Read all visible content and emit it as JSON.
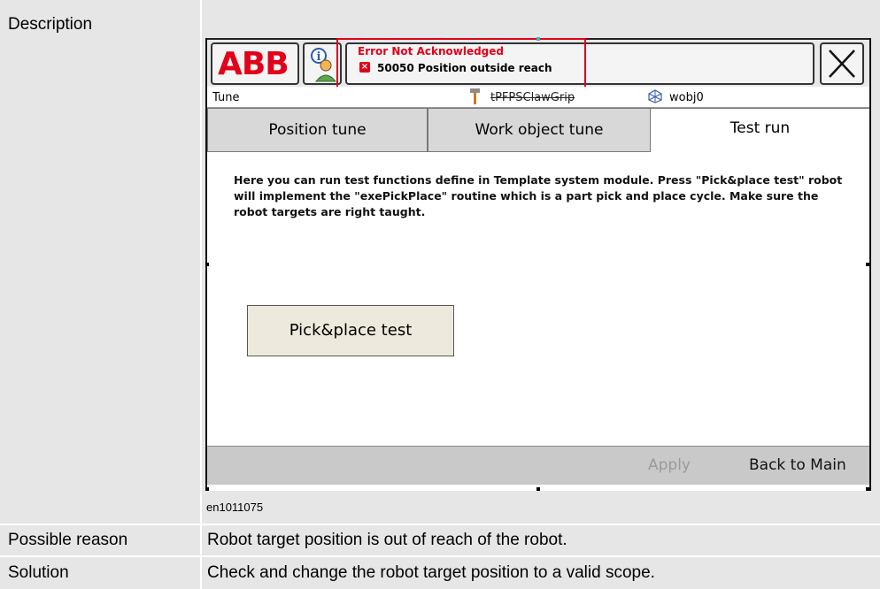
{
  "table": {
    "description_label": "Description",
    "caption": "en1011075",
    "possible_reason_label": "Possible reason",
    "possible_reason_text": "Robot target position is out of reach of the robot.",
    "solution_label": "Solution",
    "solution_text": "Check and change the robot target position to a valid scope."
  },
  "pendant": {
    "logo": "ABB",
    "status": {
      "error_title": "Error Not Acknowledged",
      "error_message": "50050 Position outside reach"
    },
    "close_glyph": "X",
    "subbar": {
      "app": "Tune",
      "task": "tPFPSClawGrip",
      "wobj": "wobj0"
    },
    "tabs": [
      "Position tune",
      "Work object tune",
      "Test run"
    ],
    "active_tab": "Test run",
    "description": "Here you can run test functions define in Template system module. Press \"Pick&place test\" robot will implement the \"exePickPlace\" routine which is a part pick and place cycle. Make sure the robot targets are right taught.",
    "pick_button": "Pick&place test",
    "apply_button": "Apply",
    "back_button": "Back to Main"
  },
  "colors": {
    "abb_red": "#e2001a",
    "error_red": "#e0001a",
    "cell_gray": "#e6e6e6"
  },
  "icons": [
    "info-user-icon",
    "error-icon",
    "close-icon",
    "tool-icon",
    "workobject-icon"
  ]
}
